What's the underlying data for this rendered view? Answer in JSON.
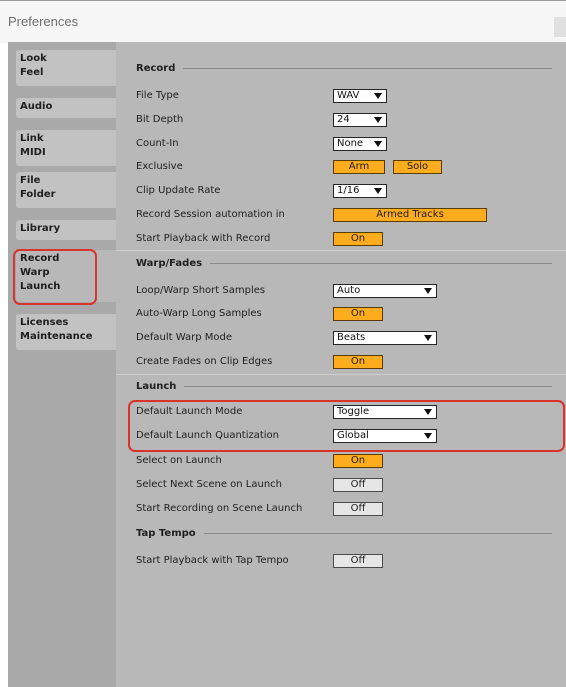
{
  "window": {
    "title": "Preferences"
  },
  "sidebar": {
    "tabs": [
      {
        "label": "Look\nFeel"
      },
      {
        "label": "Audio"
      },
      {
        "label": "Link\nMIDI"
      },
      {
        "label": "File\nFolder"
      },
      {
        "label": "Library"
      },
      {
        "label": "Record\nWarp\nLaunch"
      },
      {
        "label": "Licenses\nMaintenance"
      }
    ]
  },
  "record": {
    "heading": "Record",
    "file_type": {
      "label": "File Type",
      "value": "WAV"
    },
    "bit_depth": {
      "label": "Bit Depth",
      "value": "24"
    },
    "count_in": {
      "label": "Count-In",
      "value": "None"
    },
    "exclusive": {
      "label": "Exclusive",
      "arm": "Arm",
      "solo": "Solo"
    },
    "clip_update_rate": {
      "label": "Clip Update Rate",
      "value": "1/16"
    },
    "session_automation": {
      "label": "Record Session automation in",
      "value": "Armed Tracks"
    },
    "start_playback": {
      "label": "Start Playback with Record",
      "value": "On"
    }
  },
  "warp": {
    "heading": "Warp/Fades",
    "loop_warp_short": {
      "label": "Loop/Warp Short Samples",
      "value": "Auto"
    },
    "auto_warp_long": {
      "label": "Auto-Warp Long Samples",
      "value": "On"
    },
    "default_warp_mode": {
      "label": "Default Warp Mode",
      "value": "Beats"
    },
    "create_fades": {
      "label": "Create Fades on Clip Edges",
      "value": "On"
    }
  },
  "launch": {
    "heading": "Launch",
    "default_launch_mode": {
      "label": "Default Launch Mode",
      "value": "Toggle"
    },
    "default_launch_quantization": {
      "label": "Default Launch Quantization",
      "value": "Global"
    },
    "select_on_launch": {
      "label": "Select on Launch",
      "value": "On"
    },
    "select_next_scene": {
      "label": "Select Next Scene on Launch",
      "value": "Off"
    },
    "start_recording_scene": {
      "label": "Start Recording on Scene Launch",
      "value": "Off"
    }
  },
  "tap_tempo": {
    "heading": "Tap Tempo",
    "start_playback_tap": {
      "label": "Start Playback with Tap Tempo",
      "value": "Off"
    }
  },
  "colors": {
    "accent_on": "#ffad1e",
    "highlight_annotation": "#d9342b",
    "panel_bg": "#b8b8b8",
    "sidebar_bg": "#a9a9a9"
  }
}
